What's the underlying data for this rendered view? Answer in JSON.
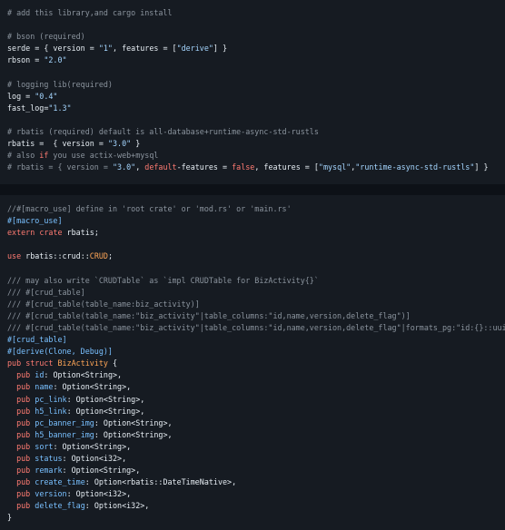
{
  "toml_block": {
    "lines": [
      [
        {
          "t": "# add this library,and cargo install",
          "c": "c"
        }
      ],
      [
        {
          "t": "",
          "c": "txt"
        }
      ],
      [
        {
          "t": "# bson (required)",
          "c": "c"
        }
      ],
      [
        {
          "t": "serde = { version = ",
          "c": "txt"
        },
        {
          "t": "\"1\"",
          "c": "str"
        },
        {
          "t": ", features = [",
          "c": "txt"
        },
        {
          "t": "\"derive\"",
          "c": "str"
        },
        {
          "t": "] }",
          "c": "txt"
        }
      ],
      [
        {
          "t": "rbson = ",
          "c": "txt"
        },
        {
          "t": "\"2.0\"",
          "c": "str"
        }
      ],
      [
        {
          "t": "",
          "c": "txt"
        }
      ],
      [
        {
          "t": "# logging lib(required)",
          "c": "c"
        }
      ],
      [
        {
          "t": "log = ",
          "c": "txt"
        },
        {
          "t": "\"0.4\"",
          "c": "str"
        }
      ],
      [
        {
          "t": "fast_log=",
          "c": "txt"
        },
        {
          "t": "\"1.3\"",
          "c": "str"
        }
      ],
      [
        {
          "t": "",
          "c": "txt"
        }
      ],
      [
        {
          "t": "# rbatis (required) default is all-database+runtime-async-std-rustls",
          "c": "c"
        }
      ],
      [
        {
          "t": "rbatis =  { version = ",
          "c": "txt"
        },
        {
          "t": "\"3.0\"",
          "c": "str"
        },
        {
          "t": " }",
          "c": "txt"
        }
      ],
      [
        {
          "t": "# also ",
          "c": "c"
        },
        {
          "t": "if",
          "c": "kw"
        },
        {
          "t": " you use actix-web+mysql",
          "c": "c"
        }
      ],
      [
        {
          "t": "# rbatis = { version = ",
          "c": "c"
        },
        {
          "t": "\"3.0\"",
          "c": "str"
        },
        {
          "t": ", ",
          "c": "txt"
        },
        {
          "t": "default",
          "c": "kw"
        },
        {
          "t": "-features = ",
          "c": "txt"
        },
        {
          "t": "false",
          "c": "kw"
        },
        {
          "t": ", features = [",
          "c": "txt"
        },
        {
          "t": "\"mysql\"",
          "c": "str"
        },
        {
          "t": ",",
          "c": "txt"
        },
        {
          "t": "\"runtime-async-std-rustls\"",
          "c": "str"
        },
        {
          "t": "] }",
          "c": "txt"
        }
      ]
    ]
  },
  "rust_block": {
    "lines": [
      [
        {
          "t": "//#[macro_use] define in 'root crate' or 'mod.rs' or 'main.rs'",
          "c": "c"
        }
      ],
      [
        {
          "t": "#[macro_use]",
          "c": "at"
        }
      ],
      [
        {
          "t": "extern",
          "c": "kw"
        },
        {
          "t": " ",
          "c": "txt"
        },
        {
          "t": "crate",
          "c": "kw"
        },
        {
          "t": " rbatis;",
          "c": "txt"
        }
      ],
      [
        {
          "t": "",
          "c": "txt"
        }
      ],
      [
        {
          "t": "use",
          "c": "kw"
        },
        {
          "t": " rbatis::crud::",
          "c": "txt"
        },
        {
          "t": "CRUD",
          "c": "ty"
        },
        {
          "t": ";",
          "c": "txt"
        }
      ],
      [
        {
          "t": "",
          "c": "txt"
        }
      ],
      [
        {
          "t": "/// may also write `CRUDTable` as `impl CRUDTable for BizActivity{}`",
          "c": "c"
        }
      ],
      [
        {
          "t": "/// #[crud_table]",
          "c": "c"
        }
      ],
      [
        {
          "t": "/// #[crud_table(table_name:biz_activity)]",
          "c": "c"
        }
      ],
      [
        {
          "t": "/// #[crud_table(table_name:\"biz_activity\"|table_columns:\"id,name,version,delete_flag\")]",
          "c": "c"
        }
      ],
      [
        {
          "t": "/// #[crud_table(table_name:\"biz_activity\"|table_columns:\"id,name,version,delete_flag\"|formats_pg:\"id:{}::uui",
          "c": "c"
        }
      ],
      [
        {
          "t": "#[crud_table]",
          "c": "at"
        }
      ],
      [
        {
          "t": "#[derive(Clone, Debug)]",
          "c": "at"
        }
      ],
      [
        {
          "t": "pub",
          "c": "kw"
        },
        {
          "t": " ",
          "c": "txt"
        },
        {
          "t": "struct",
          "c": "kw"
        },
        {
          "t": " ",
          "c": "txt"
        },
        {
          "t": "BizActivity",
          "c": "ty"
        },
        {
          "t": " {",
          "c": "txt"
        }
      ],
      [
        {
          "t": "  ",
          "c": "txt"
        },
        {
          "t": "pub",
          "c": "kw"
        },
        {
          "t": " ",
          "c": "txt"
        },
        {
          "t": "id",
          "c": "fld"
        },
        {
          "t": ": Option<String>,",
          "c": "txt"
        }
      ],
      [
        {
          "t": "  ",
          "c": "txt"
        },
        {
          "t": "pub",
          "c": "kw"
        },
        {
          "t": " ",
          "c": "txt"
        },
        {
          "t": "name",
          "c": "fld"
        },
        {
          "t": ": Option<String>,",
          "c": "txt"
        }
      ],
      [
        {
          "t": "  ",
          "c": "txt"
        },
        {
          "t": "pub",
          "c": "kw"
        },
        {
          "t": " ",
          "c": "txt"
        },
        {
          "t": "pc_link",
          "c": "fld"
        },
        {
          "t": ": Option<String>,",
          "c": "txt"
        }
      ],
      [
        {
          "t": "  ",
          "c": "txt"
        },
        {
          "t": "pub",
          "c": "kw"
        },
        {
          "t": " ",
          "c": "txt"
        },
        {
          "t": "h5_link",
          "c": "fld"
        },
        {
          "t": ": Option<String>,",
          "c": "txt"
        }
      ],
      [
        {
          "t": "  ",
          "c": "txt"
        },
        {
          "t": "pub",
          "c": "kw"
        },
        {
          "t": " ",
          "c": "txt"
        },
        {
          "t": "pc_banner_img",
          "c": "fld"
        },
        {
          "t": ": Option<String>,",
          "c": "txt"
        }
      ],
      [
        {
          "t": "  ",
          "c": "txt"
        },
        {
          "t": "pub",
          "c": "kw"
        },
        {
          "t": " ",
          "c": "txt"
        },
        {
          "t": "h5_banner_img",
          "c": "fld"
        },
        {
          "t": ": Option<String>,",
          "c": "txt"
        }
      ],
      [
        {
          "t": "  ",
          "c": "txt"
        },
        {
          "t": "pub",
          "c": "kw"
        },
        {
          "t": " ",
          "c": "txt"
        },
        {
          "t": "sort",
          "c": "fld"
        },
        {
          "t": ": Option<String>,",
          "c": "txt"
        }
      ],
      [
        {
          "t": "  ",
          "c": "txt"
        },
        {
          "t": "pub",
          "c": "kw"
        },
        {
          "t": " ",
          "c": "txt"
        },
        {
          "t": "status",
          "c": "fld"
        },
        {
          "t": ": Option<i32>,",
          "c": "txt"
        }
      ],
      [
        {
          "t": "  ",
          "c": "txt"
        },
        {
          "t": "pub",
          "c": "kw"
        },
        {
          "t": " ",
          "c": "txt"
        },
        {
          "t": "remark",
          "c": "fld"
        },
        {
          "t": ": Option<String>,",
          "c": "txt"
        }
      ],
      [
        {
          "t": "  ",
          "c": "txt"
        },
        {
          "t": "pub",
          "c": "kw"
        },
        {
          "t": " ",
          "c": "txt"
        },
        {
          "t": "create_time",
          "c": "fld"
        },
        {
          "t": ": Option<rbatis::DateTimeNative>,",
          "c": "txt"
        }
      ],
      [
        {
          "t": "  ",
          "c": "txt"
        },
        {
          "t": "pub",
          "c": "kw"
        },
        {
          "t": " ",
          "c": "txt"
        },
        {
          "t": "version",
          "c": "fld"
        },
        {
          "t": ": Option<i32>,",
          "c": "txt"
        }
      ],
      [
        {
          "t": "  ",
          "c": "txt"
        },
        {
          "t": "pub",
          "c": "kw"
        },
        {
          "t": " ",
          "c": "txt"
        },
        {
          "t": "delete_flag",
          "c": "fld"
        },
        {
          "t": ": Option<i32>,",
          "c": "txt"
        }
      ],
      [
        {
          "t": "}",
          "c": "txt"
        }
      ]
    ]
  },
  "colors": {
    "page_background": "#0d1117",
    "code_background": "#161b22",
    "text": "#e6edf3",
    "comment": "#8b949e",
    "keyword": "#ff7b72",
    "string": "#a5d6ff",
    "type": "#ffa657",
    "attribute": "#79c0ff"
  }
}
